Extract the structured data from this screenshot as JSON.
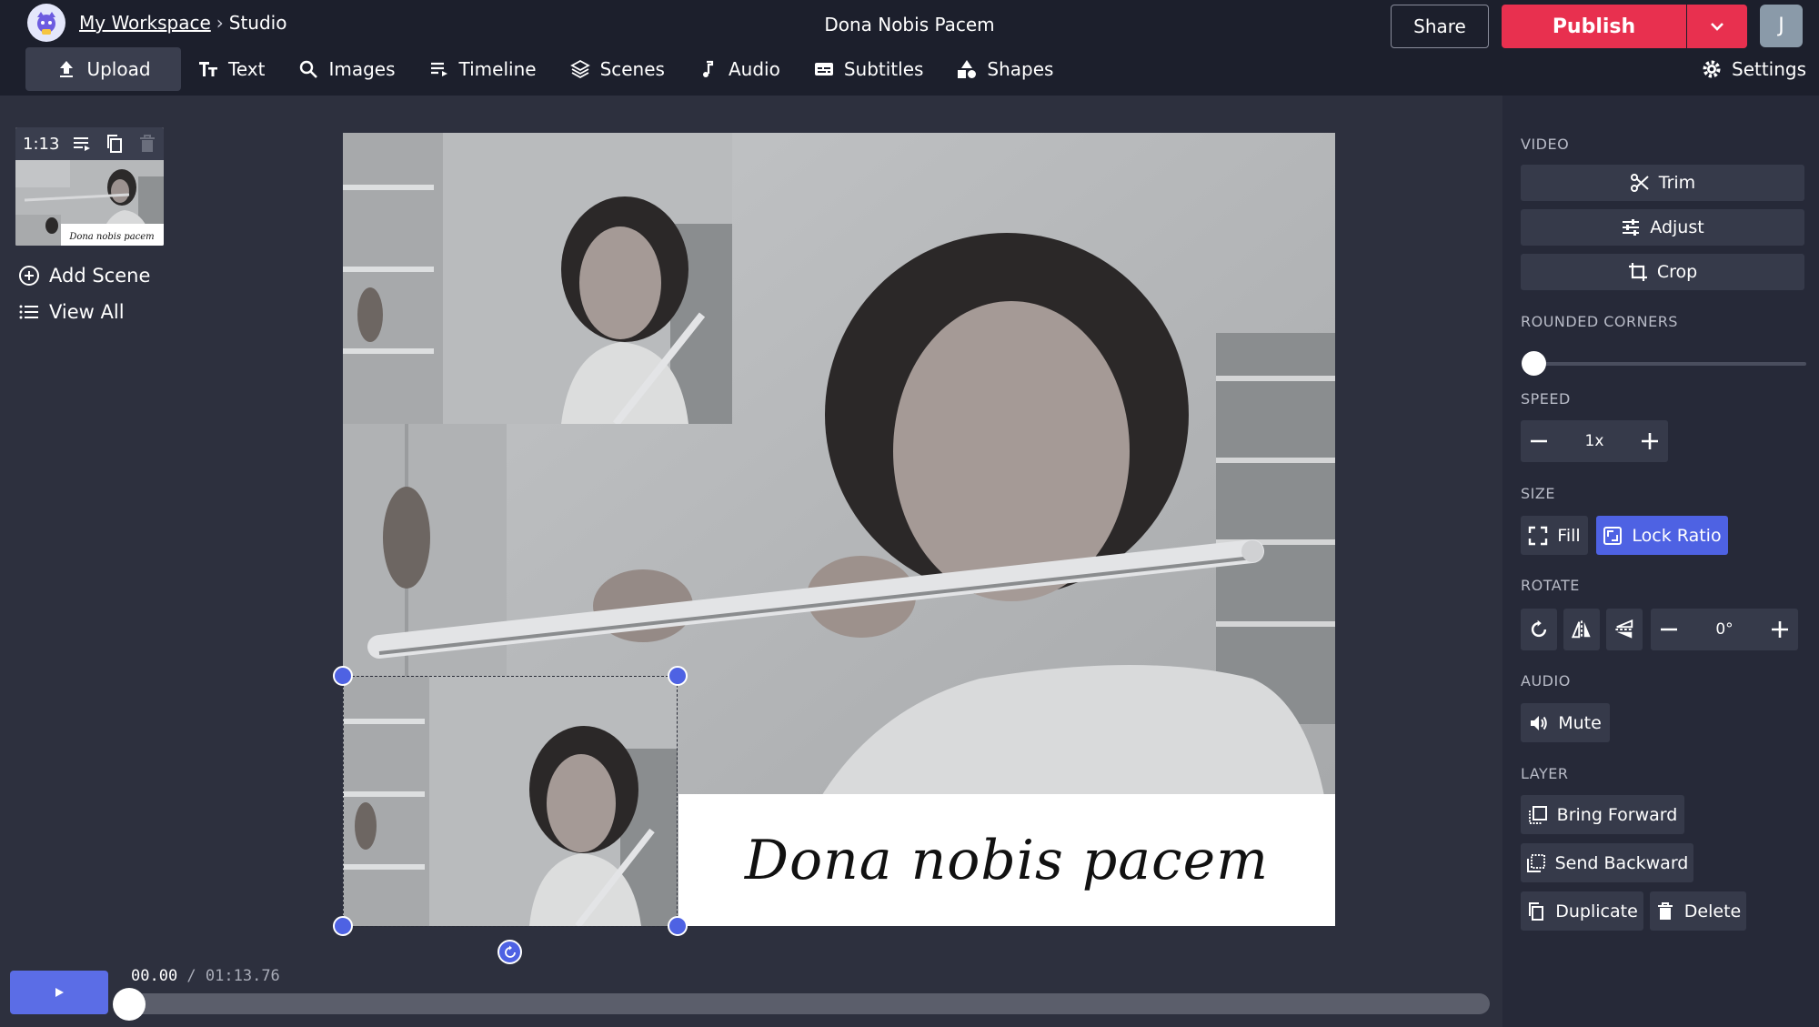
{
  "header": {
    "workspace": "My Workspace",
    "separator": "›",
    "section": "Studio",
    "project_title": "Dona Nobis Pacem",
    "share_label": "Share",
    "publish_label": "Publish",
    "avatar_initial": "J"
  },
  "toolbar": {
    "upload": "Upload",
    "text": "Text",
    "images": "Images",
    "timeline": "Timeline",
    "scenes": "Scenes",
    "audio": "Audio",
    "subtitles": "Subtitles",
    "shapes": "Shapes",
    "settings": "Settings"
  },
  "scenes": {
    "duration": "1:13",
    "thumb_caption": "Dona nobis pacem",
    "add_scene": "Add Scene",
    "view_all": "View All"
  },
  "canvas": {
    "caption": "Dona nobis pacem"
  },
  "playback": {
    "current": "00.00",
    "divider": " / ",
    "total": "01:13.76",
    "progress": 0
  },
  "panel": {
    "video_label": "VIDEO",
    "trim": "Trim",
    "adjust": "Adjust",
    "crop": "Crop",
    "rounded_label": "ROUNDED CORNERS",
    "rounded_value": 0,
    "speed_label": "SPEED",
    "speed_value": "1x",
    "size_label": "SIZE",
    "fill": "Fill",
    "lock_ratio": "Lock Ratio",
    "rotate_label": "ROTATE",
    "rotate_value": "0°",
    "audio_label": "AUDIO",
    "mute": "Mute",
    "layer_label": "LAYER",
    "bring_forward": "Bring Forward",
    "send_backward": "Send Backward",
    "duplicate": "Duplicate",
    "delete": "Delete"
  },
  "colors": {
    "accent": "#4e62e3",
    "publish": "#e8304f",
    "topbar": "#1c1f2c",
    "panel": "#262938"
  }
}
